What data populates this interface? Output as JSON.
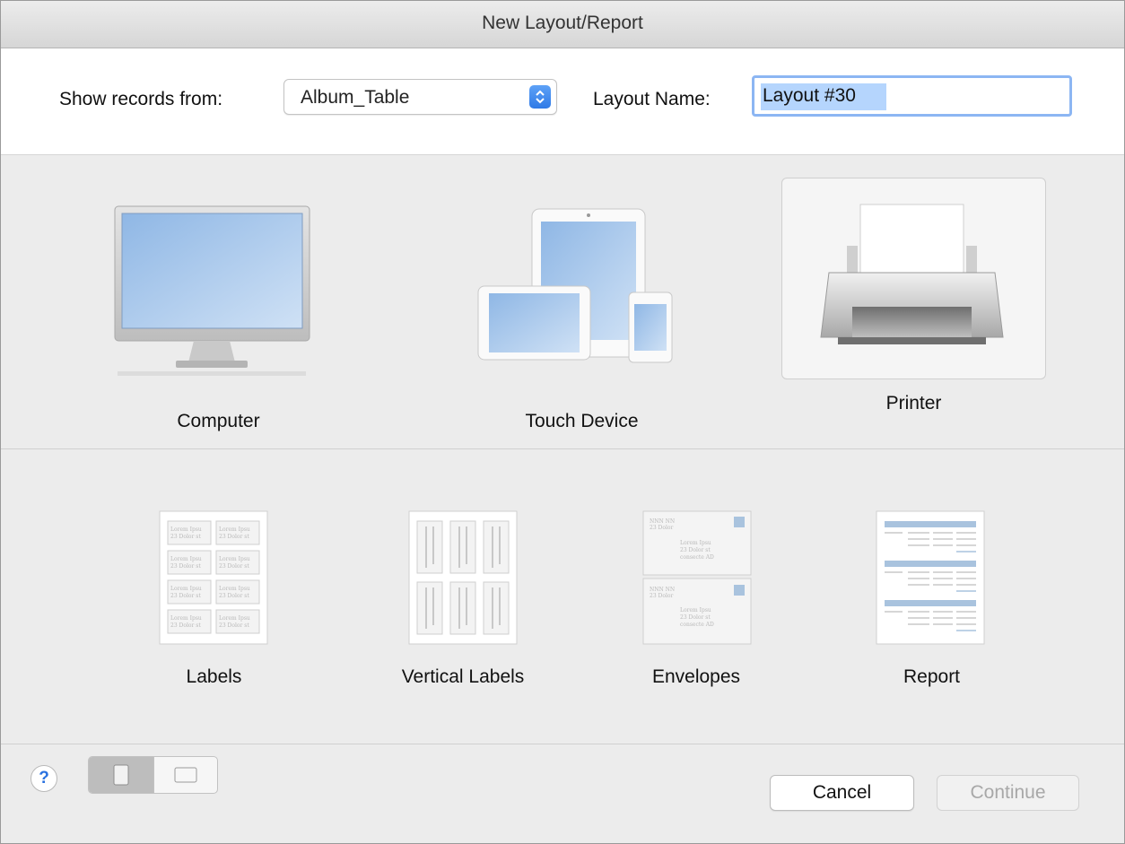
{
  "window": {
    "title": "New Layout/Report"
  },
  "header": {
    "show_records_label": "Show records from:",
    "table_select_value": "Album_Table",
    "layout_name_label": "Layout Name:",
    "layout_name_value": "Layout #30"
  },
  "devices": [
    {
      "label": "Computer",
      "icon": "computer-monitor-icon"
    },
    {
      "label": "Touch Device",
      "icon": "touch-devices-icon"
    },
    {
      "label": "Printer",
      "icon": "printer-icon",
      "selected": true
    }
  ],
  "layout_types": [
    {
      "label": "Labels",
      "icon": "labels-icon"
    },
    {
      "label": "Vertical Labels",
      "icon": "vertical-labels-icon"
    },
    {
      "label": "Envelopes",
      "icon": "envelopes-icon"
    },
    {
      "label": "Report",
      "icon": "report-icon"
    }
  ],
  "icon_sample_text": {
    "label_line1": "Lorem Ipsu",
    "label_line2": "23 Dolor st",
    "env_return1": "NNN NN",
    "env_return2": "23 Dolor",
    "env_addr1": "Lorem Ipsu",
    "env_addr2": "23 Dolor st",
    "env_addr3": "consecte AD"
  },
  "footer": {
    "help_label": "?",
    "orientation": {
      "portrait_icon": "portrait-page-icon",
      "landscape_icon": "landscape-page-icon",
      "selected": "portrait"
    },
    "cancel_label": "Cancel",
    "continue_label": "Continue"
  },
  "colors": {
    "accent": "#2f7ae6",
    "focus_ring": "#8cb6f3",
    "selection": "#b5d5fd"
  }
}
